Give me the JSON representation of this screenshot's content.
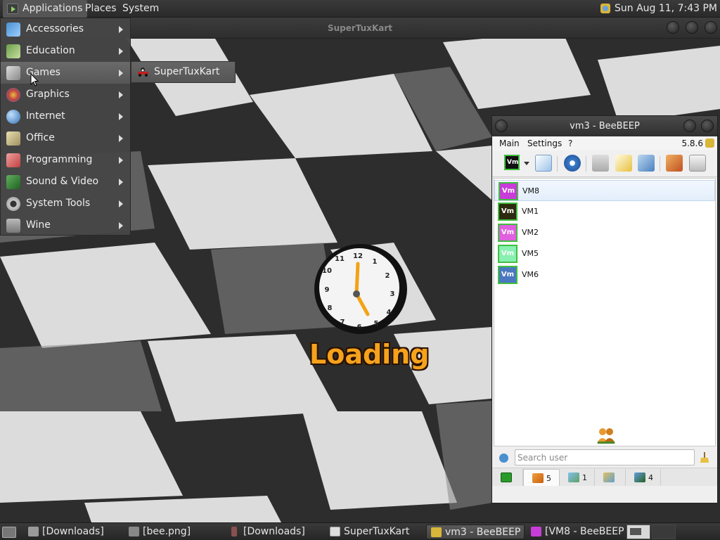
{
  "top_panel": {
    "applications": "Applications",
    "places": "Places",
    "system": "System",
    "clock": "Sun Aug 11,  7:43 PM"
  },
  "game_window": {
    "title": "SuperTuxKart",
    "loading_text": "Loading"
  },
  "app_menu": {
    "items": [
      {
        "label": "Accessories",
        "icon": "accessories-icon"
      },
      {
        "label": "Education",
        "icon": "education-icon"
      },
      {
        "label": "Games",
        "icon": "games-icon"
      },
      {
        "label": "Graphics",
        "icon": "graphics-icon"
      },
      {
        "label": "Internet",
        "icon": "internet-icon"
      },
      {
        "label": "Office",
        "icon": "office-icon"
      },
      {
        "label": "Programming",
        "icon": "programming-icon"
      },
      {
        "label": "Sound & Video",
        "icon": "sound-video-icon"
      },
      {
        "label": "System Tools",
        "icon": "system-tools-icon"
      },
      {
        "label": "Wine",
        "icon": "wine-icon"
      }
    ],
    "active_item": "Games",
    "submenu": {
      "label": "SuperTuxKart",
      "icon": "supertuxkart-icon"
    }
  },
  "beebeep": {
    "title": "vm3 - BeeBEEP",
    "menu": [
      "Main",
      "Settings",
      "?"
    ],
    "version": "5.8.6",
    "users": [
      {
        "name": "VM8",
        "badge": "Vm",
        "color": "#c83cd8",
        "selected": true
      },
      {
        "name": "VM1",
        "badge": "Vm",
        "color": "#2e2a10",
        "selected": false
      },
      {
        "name": "VM2",
        "badge": "Vm",
        "color": "#e060e0",
        "selected": false
      },
      {
        "name": "VM5",
        "badge": "Vm",
        "color": "#88f0b0",
        "selected": false
      },
      {
        "name": "VM6",
        "badge": "Vm",
        "color": "#4a78c0",
        "selected": false
      }
    ],
    "search_placeholder": "Search user",
    "tabs": [
      {
        "icon": "network-icon",
        "count": ""
      },
      {
        "icon": "users-icon",
        "count": "5"
      },
      {
        "icon": "chats-icon",
        "count": "1"
      },
      {
        "icon": "groups-icon",
        "count": ""
      },
      {
        "icon": "files-icon",
        "count": "4"
      }
    ]
  },
  "taskbar": {
    "tasks": [
      {
        "label": "[Downloads]",
        "icon": "folder-icon"
      },
      {
        "label": "[bee.png]",
        "icon": "image-icon"
      },
      {
        "label": "[Downloads]",
        "icon": "folder-icon"
      },
      {
        "label": "SuperTuxKart",
        "icon": "window-icon"
      },
      {
        "label": "vm3 - BeeBEEP",
        "icon": "beebeep-icon"
      },
      {
        "label": "[VM8 - BeeBEEP ...",
        "icon": "vm-icon"
      }
    ]
  }
}
